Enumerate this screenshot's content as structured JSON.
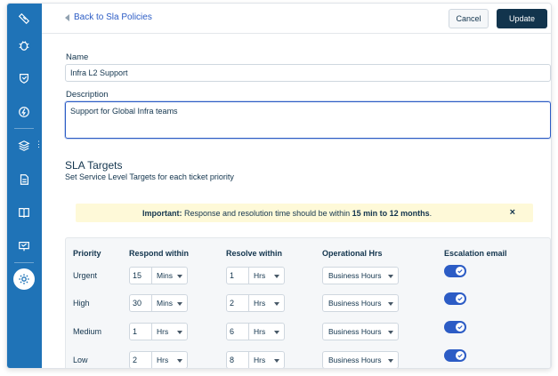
{
  "header": {
    "back_label": "Back to Sla Policies",
    "cancel_label": "Cancel",
    "update_label": "Update"
  },
  "form": {
    "name_label": "Name",
    "name_value": "Infra L2  Support",
    "description_label": "Description",
    "description_value": "Support for Global Infra teams"
  },
  "sla": {
    "title": "SLA Targets",
    "subtitle": "Set Service Level Targets for each ticket priority",
    "notice_strong": "Important:",
    "notice_text": " Response and resolution time should be within ",
    "notice_range": "15 min to 12 months",
    "notice_end": ".",
    "notice_close": "×",
    "columns": {
      "priority": "Priority",
      "respond": "Respond within",
      "resolve": "Resolve within",
      "hours": "Operational Hrs",
      "escalation": "Escalation email"
    },
    "rows": [
      {
        "priority": "Urgent",
        "respond_value": "15",
        "respond_unit": "Mins",
        "resolve_value": "1",
        "resolve_unit": "Hrs",
        "hours": "Business Hours",
        "escalation": true
      },
      {
        "priority": "High",
        "respond_value": "30",
        "respond_unit": "Mins",
        "resolve_value": "2",
        "resolve_unit": "Hrs",
        "hours": "Business Hours",
        "escalation": true
      },
      {
        "priority": "Medium",
        "respond_value": "1",
        "respond_unit": "Hrs",
        "resolve_value": "6",
        "resolve_unit": "Hrs",
        "hours": "Business Hours",
        "escalation": true
      },
      {
        "priority": "Low",
        "respond_value": "2",
        "respond_unit": "Hrs",
        "resolve_value": "8",
        "resolve_unit": "Hrs",
        "hours": "Business Hours",
        "escalation": true
      }
    ]
  },
  "sidebar": {
    "icons": [
      "ticket-icon",
      "bug-icon",
      "shield-icon",
      "bolt-icon",
      "layers-icon",
      "document-icon",
      "book-icon",
      "presentation-icon",
      "gear-icon"
    ],
    "active": "gear-icon"
  },
  "colors": {
    "sidebar": "#1f73b7",
    "primary_button": "#12344d",
    "link": "#2c5cc5",
    "notice_bg": "#fef9d8",
    "toggle_on": "#2c5cc5"
  }
}
